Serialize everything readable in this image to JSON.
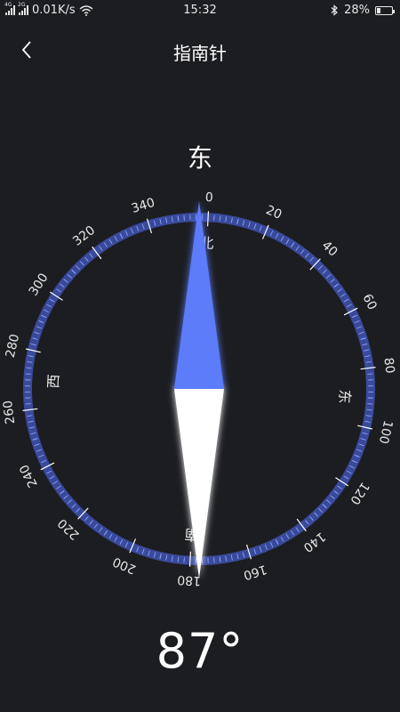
{
  "status_bar": {
    "signal1_tag": "4G",
    "signal2_tag": "2G",
    "speed": "0.01K/s",
    "time": "15:32",
    "battery": "28%",
    "battery_level": 0.28
  },
  "nav": {
    "title": "指南针"
  },
  "direction": "东",
  "heading": "87°",
  "compass": {
    "rotation_deg": -87,
    "ring_color": "#3a4a9a",
    "tick_color": "#8ea0ff",
    "needle_north_color": "#5b7cfa",
    "needle_south_color": "#ffffff",
    "degree_labels": [
      "0",
      "20",
      "40",
      "60",
      "80",
      "100",
      "120",
      "140",
      "160",
      "180",
      "200",
      "220",
      "240",
      "260",
      "280",
      "300",
      "320",
      "340"
    ],
    "cardinals": [
      {
        "deg": 0,
        "label": "北"
      },
      {
        "deg": 90,
        "label": "东"
      },
      {
        "deg": 180,
        "label": "南"
      },
      {
        "deg": 270,
        "label": "西"
      }
    ]
  }
}
